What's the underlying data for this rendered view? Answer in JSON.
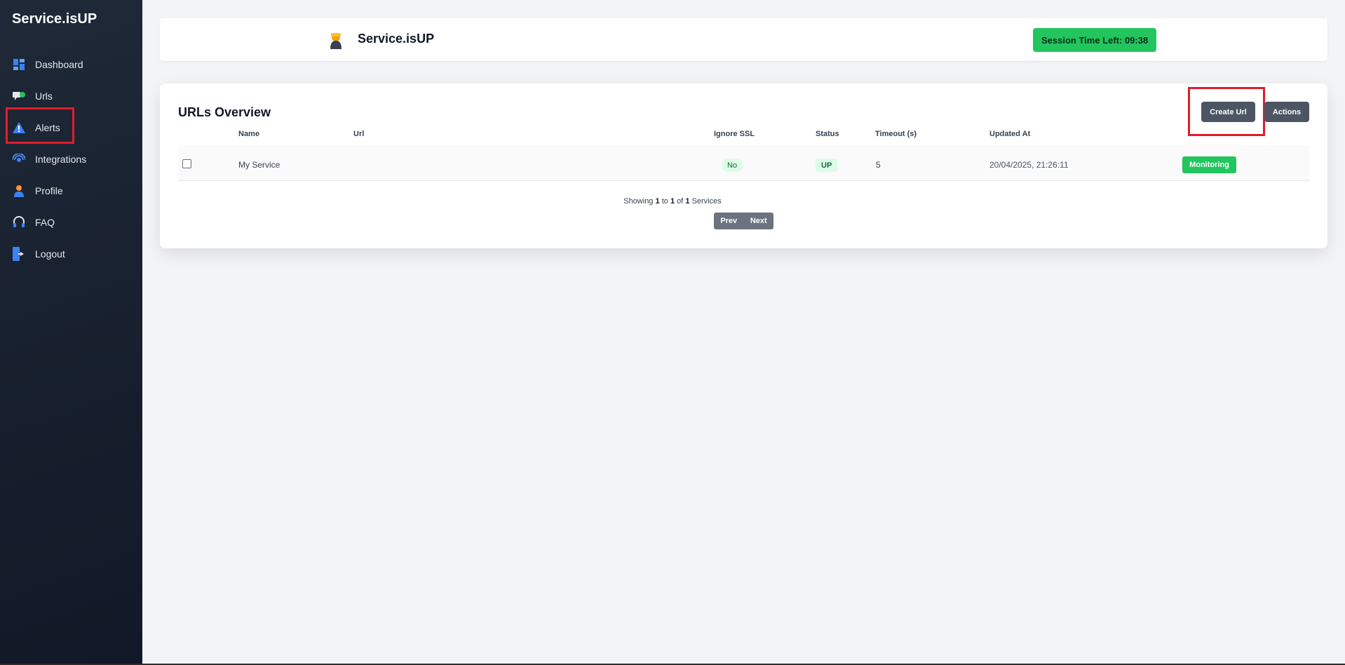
{
  "sidebar": {
    "brand": "Service.isUP",
    "items": [
      {
        "label": "Dashboard",
        "icon": "dashboard-icon"
      },
      {
        "label": "Urls",
        "icon": "urls-icon"
      },
      {
        "label": "Alerts",
        "icon": "alert-icon"
      },
      {
        "label": "Integrations",
        "icon": "integrations-icon"
      },
      {
        "label": "Profile",
        "icon": "profile-icon"
      },
      {
        "label": "FAQ",
        "icon": "headset-icon"
      },
      {
        "label": "Logout",
        "icon": "logout-icon"
      }
    ]
  },
  "header": {
    "title": "Service.isUP",
    "session_label": "Session Time Left: 09:38"
  },
  "card": {
    "title": "URLs Overview",
    "create_label": "Create Url",
    "actions_label": "Actions",
    "columns": [
      "Name",
      "Url",
      "Ignore SSL",
      "Status",
      "Timeout (s)",
      "Updated At"
    ],
    "rows": [
      {
        "name": "My Service",
        "url": "",
        "ignore_ssl": "No",
        "status": "UP",
        "timeout": "5",
        "updated_at": "20/04/2025, 21:26:11",
        "action": "Monitoring"
      }
    ],
    "showing": {
      "prefix": "Showing",
      "from": "1",
      "to_word": "to",
      "to": "1",
      "of_word": "of",
      "total": "1",
      "suffix": "Services"
    },
    "prev_label": "Prev",
    "next_label": "Next"
  },
  "colors": {
    "sidebar_bg": "#1f2937",
    "accent_green": "#22c55e",
    "button_dark": "#4b5563",
    "highlight_red": "#e11d2a"
  }
}
